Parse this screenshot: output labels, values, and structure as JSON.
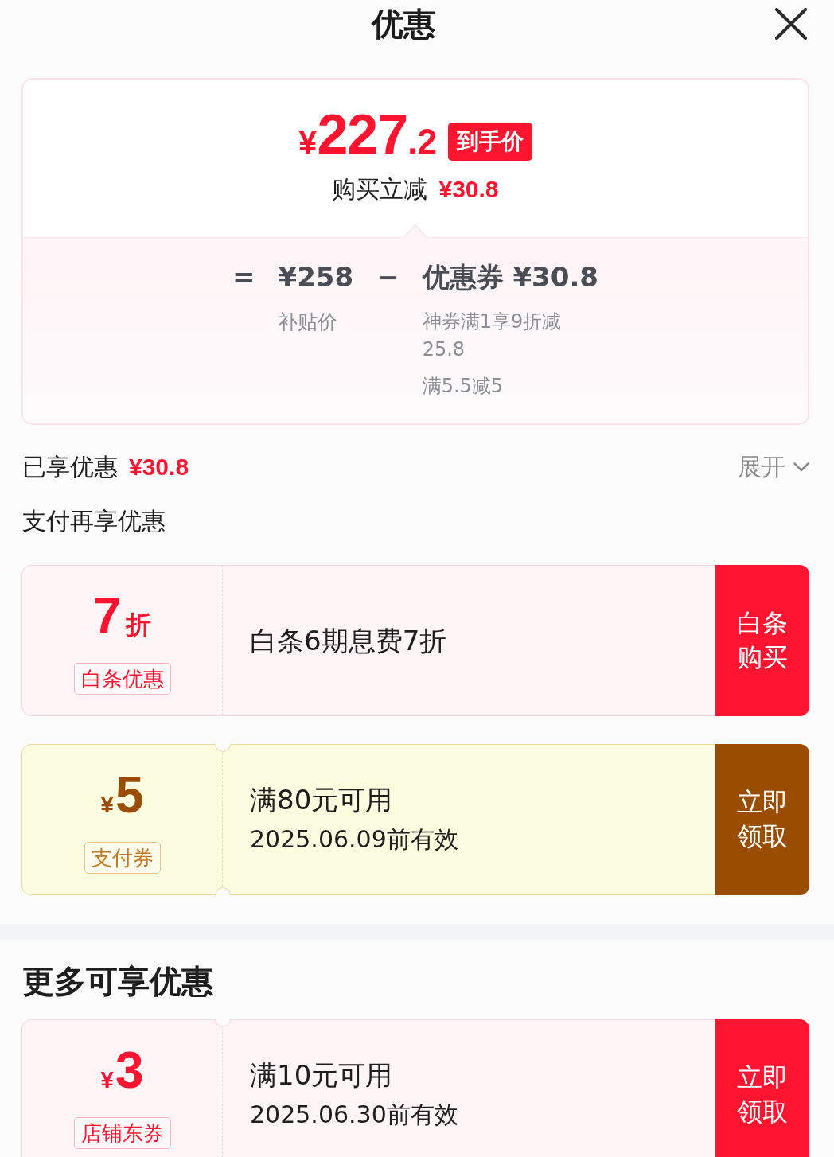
{
  "header": {
    "title": "优惠"
  },
  "summary": {
    "final_price": "¥227.2",
    "price_badge": "到手价",
    "instant_saving": {
      "label": "购买立减",
      "amount": "¥30.8"
    },
    "breakdown": {
      "equals_sign": "=",
      "subsidy": {
        "amount": "¥258",
        "label": "补贴价"
      },
      "minus_sign": "−",
      "coupon": {
        "amount": "优惠券 ¥30.8",
        "details": [
          "神券满1享9折减25.8",
          "满5.5减5"
        ]
      }
    }
  },
  "enjoyed": {
    "label": "已享优惠",
    "amount": "¥30.8",
    "toggle": "展开",
    "expanded": false
  },
  "payment_offers": {
    "title": "支付再享优惠",
    "items": [
      {
        "kind": "discount",
        "value": "7折",
        "tag": "白条优惠",
        "title": "白条6期息费7折",
        "button": "白条购买"
      },
      {
        "kind": "pay_coupon",
        "value": "¥5",
        "tag": "支付券",
        "title": "满80元可用",
        "validity": "2025.06.09前有效",
        "button": "立即领取"
      }
    ]
  },
  "more_offers": {
    "title": "更多可享优惠",
    "items": [
      {
        "kind": "shop_coupon",
        "value": "¥3",
        "tag": "店铺东券",
        "title": "满10元可用",
        "validity": "2025.06.30前有效",
        "button": "立即领取"
      }
    ]
  }
}
